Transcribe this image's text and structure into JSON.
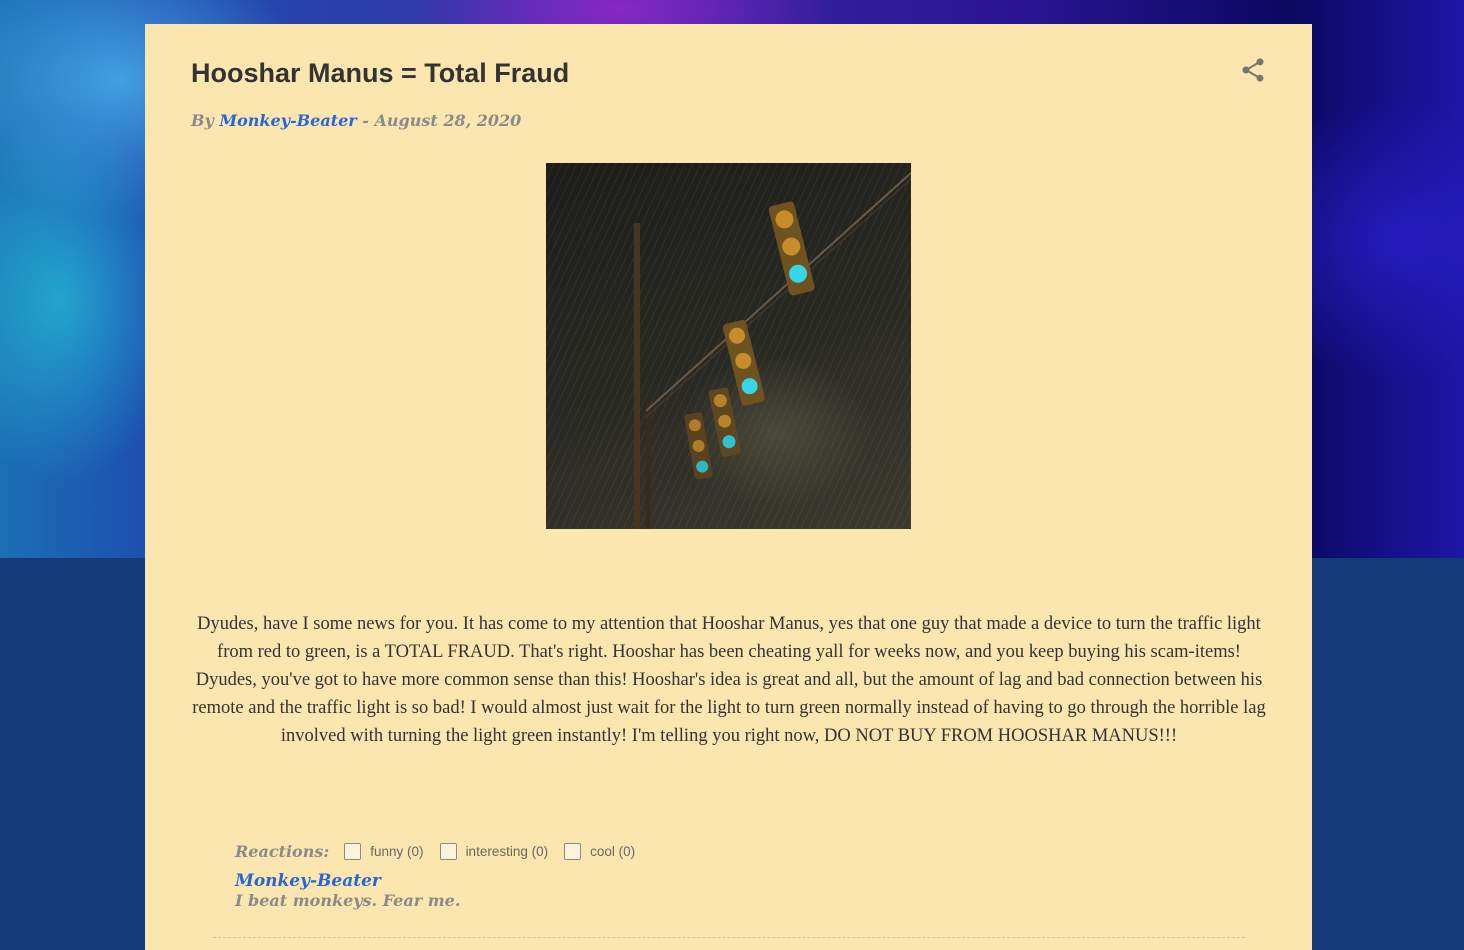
{
  "post": {
    "title": "Hooshar Manus = Total Fraud",
    "byline_prefix": "By",
    "author": "Monkey-Beater",
    "byline_separator": "-",
    "date": "August 28, 2020",
    "share_icon": "share-icon",
    "image": "traffic-lights-in-rain",
    "body": "Dyudes, have I some news for you. It has come to my attention that Hooshar Manus, yes that one guy that made a device to turn the traffic light from red to green, is a TOTAL FRAUD. That's right. Hooshar has been cheating yall for weeks now, and you keep buying his scam-items! Dyudes, you've got to have more common sense than this! Hooshar's idea is great and all, but the amount of lag and bad connection between his remote and the traffic light is so bad! I would almost just wait for the light to turn green normally instead of having to go through the horrible lag involved with turning the light green instantly! I'm telling you right now, DO NOT BUY FROM HOOSHAR MANUS!!!"
  },
  "reactions": {
    "label": "Reactions:",
    "items": [
      {
        "label": "funny (0)",
        "checked": false
      },
      {
        "label": "interesting (0)",
        "checked": false
      },
      {
        "label": "cool (0)",
        "checked": false
      }
    ]
  },
  "author_profile": {
    "name": "Monkey-Beater",
    "bio": "I beat monkeys. Fear me."
  },
  "colors": {
    "post_background": "#fce6b0",
    "link": "#2766d6",
    "page_background": "#143a7a"
  }
}
